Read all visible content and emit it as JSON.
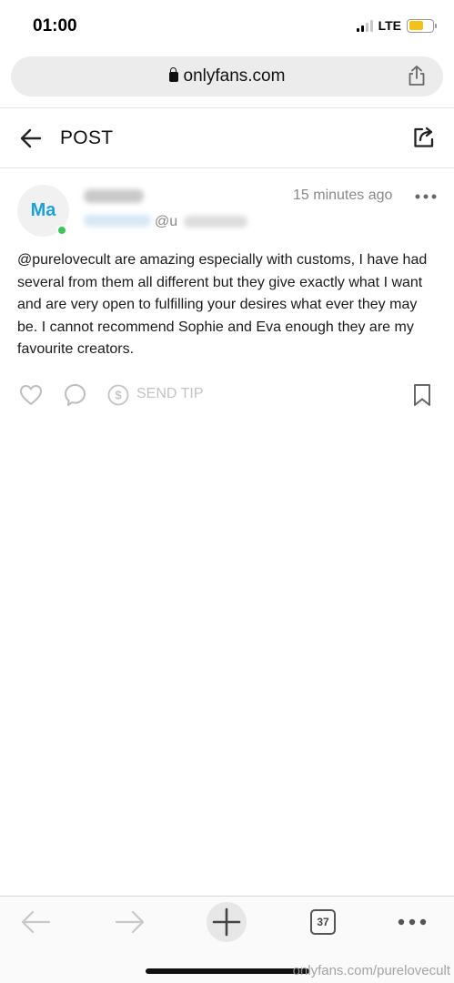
{
  "status_bar": {
    "time": "01:00",
    "network": "LTE",
    "signal_bars": 2,
    "signal_bars_total": 4,
    "battery_level": 0.6,
    "battery_color": "#f2c316"
  },
  "browser": {
    "url": "onlyfans.com",
    "lock_icon": "lock-icon",
    "share_icon": "share-icon"
  },
  "header": {
    "title": "POST",
    "back_icon": "arrow-left-icon",
    "share_icon": "share-external-icon"
  },
  "post": {
    "avatar_initials": "Ma",
    "avatar_color": "#1da1d6",
    "online_color": "#3cc65a",
    "handle_prefix": "@u",
    "time": "15 minutes ago",
    "text": "@purelovecult are amazing especially with customs, I have had several from them all different but they give exactly what I want and are very open to fulfilling your desires what ever they may be. I cannot recommend Sophie and Eva enough they are my favourite creators."
  },
  "actions": {
    "like_icon": "heart-icon",
    "comment_icon": "comment-icon",
    "tip_icon": "dollar-circle-icon",
    "tip_label": "SEND TIP",
    "bookmark_icon": "bookmark-icon"
  },
  "toolbar": {
    "tabs_count": "37"
  },
  "watermark": "onlyfans.com/purelovecult"
}
